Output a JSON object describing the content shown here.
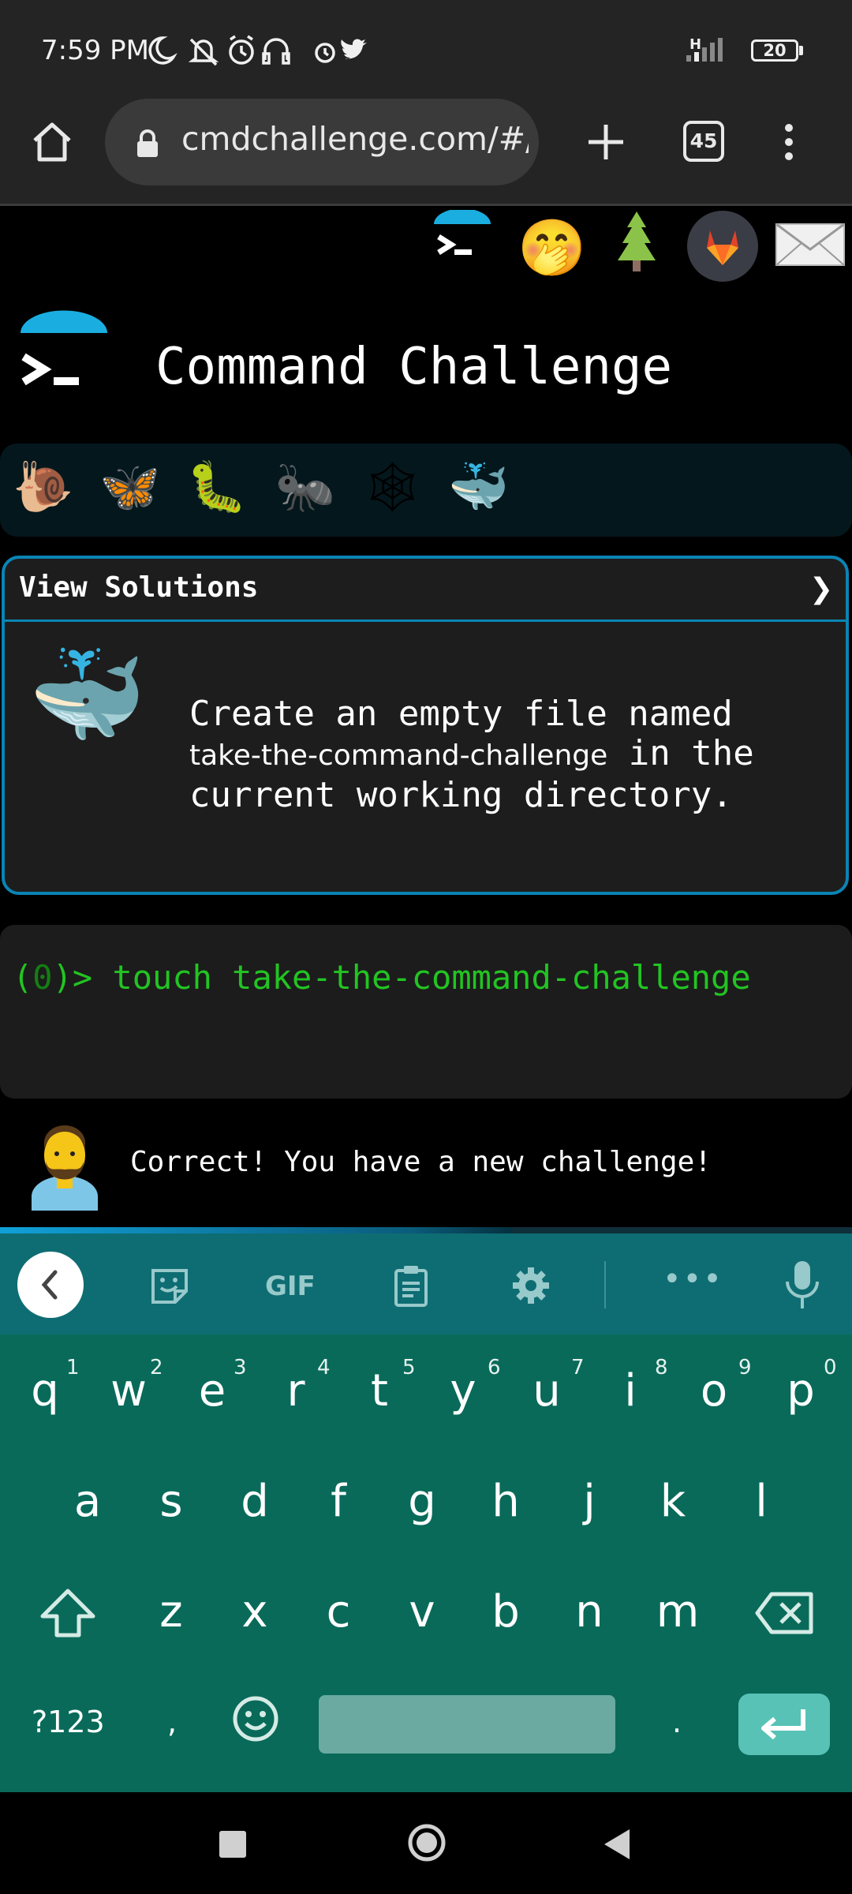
{
  "status_bar": {
    "time": "7:59 PM",
    "icons": [
      "moon-icon",
      "bell-off-icon",
      "alarm-icon",
      "headphones-icon",
      "alarm-icon",
      "twitter-icon"
    ],
    "network_label": "H",
    "battery": "20"
  },
  "browser": {
    "url": "cmdchallenge.com/#/",
    "tab_count": "45"
  },
  "page": {
    "title": "Command Challenge",
    "header_icons": [
      "terminal-logo-icon",
      "face-with-hand-over-mouth-icon",
      "tree-icon",
      "gitlab-icon",
      "envelope-icon"
    ],
    "levels": [
      {
        "name": "snail",
        "emoji": "🐌"
      },
      {
        "name": "butterfly",
        "emoji": "🦋"
      },
      {
        "name": "caterpillar",
        "emoji": "🐛"
      },
      {
        "name": "ant",
        "emoji": "🐜"
      },
      {
        "name": "spider-web",
        "emoji": "🕸"
      },
      {
        "name": "whale",
        "emoji": "🐳"
      }
    ],
    "solutions_label": "View Solutions",
    "solutions_chevron": "❯",
    "challenge": {
      "text_before": "Create an empty file named",
      "filename": "take-the-command-challenge",
      "text_after": " in the current working directory."
    },
    "terminal": {
      "prompt_open": "(",
      "prompt_count": "0",
      "prompt_close": ")>",
      "command": " touch take-the-command-challenge"
    },
    "feedback": "Correct! You have a new challenge!",
    "progress_fraction": 0.6
  },
  "keyboard": {
    "toolbar": {
      "gif": "GIF"
    },
    "row1": [
      "q",
      "w",
      "e",
      "r",
      "t",
      "y",
      "u",
      "i",
      "o",
      "p"
    ],
    "row1_nums": [
      "1",
      "2",
      "3",
      "4",
      "5",
      "6",
      "7",
      "8",
      "9",
      "0"
    ],
    "row2": [
      "a",
      "s",
      "d",
      "f",
      "g",
      "h",
      "j",
      "k",
      "l"
    ],
    "row3": [
      "z",
      "x",
      "c",
      "v",
      "b",
      "n",
      "m"
    ],
    "symbols_key": "?123",
    "comma_key": ",",
    "period_key": "."
  },
  "colors": {
    "accent": "#0a84b4",
    "terminal_green": "#22c422",
    "keyboard_bg": "#096a5a"
  }
}
